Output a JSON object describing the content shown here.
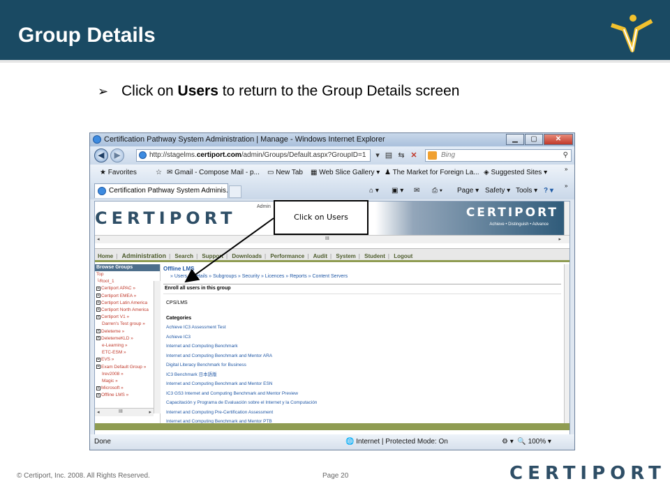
{
  "slide": {
    "title": "Group Details",
    "bullet_prefix": "Click on ",
    "bullet_bold": "Users",
    "bullet_suffix": " to return to the Group Details screen",
    "callout": "Click on Users",
    "footer_copyright": "© Certiport, Inc. 2008. All Rights Reserved.",
    "footer_page": "Page 20",
    "footer_logo": "CERTIPORT"
  },
  "browser": {
    "window_title": "Certification Pathway System Administration | Manage - Windows Internet Explorer",
    "url_prefix": "http://stagelms.",
    "url_domain": "certiport.com",
    "url_suffix": "/admin/Groups/Default.aspx?GroupID=1",
    "search_placeholder": "Bing",
    "favorites": [
      "Favorites",
      "Gmail - Compose Mail - p...",
      "New Tab",
      "Web Slice Gallery ▾",
      "The Market for Foreign La...",
      "Suggested Sites ▾"
    ],
    "tab_title": "Certification Pathway System Adminis...",
    "commands": [
      "Page ▾",
      "Safety ▾",
      "Tools ▾"
    ],
    "status_left": "Done",
    "status_zone": "Internet | Protected Mode: On",
    "status_zoom": "100%"
  },
  "site": {
    "logo": "CERTIPORT",
    "logo_right": "CERTIPORT",
    "tagline": "Achieve • Distinguish • Advance",
    "admin_tag": "Admin",
    "menu": [
      "Home",
      "Administration",
      "Search",
      "Support",
      "Downloads",
      "Performance",
      "Audit",
      "System",
      "Student",
      "Logout"
    ],
    "browse_header": "Browse Groups",
    "tree": [
      {
        "label": "Top",
        "box": false,
        "indent": false
      },
      {
        "label": "└Root_1",
        "box": false,
        "indent": false
      },
      {
        "label": "Certiport APAC »",
        "box": true,
        "indent": false
      },
      {
        "label": "Certiport EMEA »",
        "box": true,
        "indent": false
      },
      {
        "label": "Certiport Latin America",
        "box": true,
        "indent": false
      },
      {
        "label": "Certiport North America",
        "box": true,
        "indent": false
      },
      {
        "label": "Certiport V1 »",
        "box": true,
        "indent": false
      },
      {
        "label": "Darren's Test group »",
        "box": false,
        "indent": true
      },
      {
        "label": "Deleteme »",
        "box": true,
        "indent": false
      },
      {
        "label": "DeletemeKLD »",
        "box": true,
        "indent": false
      },
      {
        "label": "e-Learning »",
        "box": false,
        "indent": true
      },
      {
        "label": "ETC-ESM »",
        "box": false,
        "indent": true
      },
      {
        "label": "EVS »",
        "box": true,
        "indent": false
      },
      {
        "label": "Exam Default Group »",
        "box": true,
        "indent": false
      },
      {
        "label": "Irev2008 »",
        "box": false,
        "indent": true
      },
      {
        "label": "Magic »",
        "box": false,
        "indent": true
      },
      {
        "label": "Microsoft »",
        "box": true,
        "indent": false
      },
      {
        "label": "Offline LMS »",
        "box": true,
        "indent": false
      }
    ],
    "group_title": "Offline LMS",
    "subnav": "» Users   » Details   » Subgroups   » Security   » Licences   » Reports   » Content Servers",
    "enroll": "Enroll all users in this group",
    "cps": "CPS/LMS",
    "categories_label": "Categories",
    "categories": [
      "Achieve IC3 Assessment Test",
      "Achieve IC3",
      "Internet and Computing Benchmark",
      "Internet and Computing Benchmark and Mentor ARA",
      "Digital Literacy Benchmark for Business",
      "IC3 Benchmark 日本語版",
      "Internet and Computing Benchmark and Mentor ESN",
      "IC3 GS3 Internet and Computing Benchmark and Mentor Preview",
      "Capacitación y Programa de Evaluación sobre el Internet y la Computación",
      "Internet and Computing Pre-Certification Assessment",
      "Internet and Computing Benchmark and Mentor PTB"
    ]
  },
  "colors": {
    "header_blue": "#1a4a63",
    "menu_olive": "#8f9c52",
    "link_blue": "#1f57a5",
    "tree_red": "#c0392b"
  }
}
